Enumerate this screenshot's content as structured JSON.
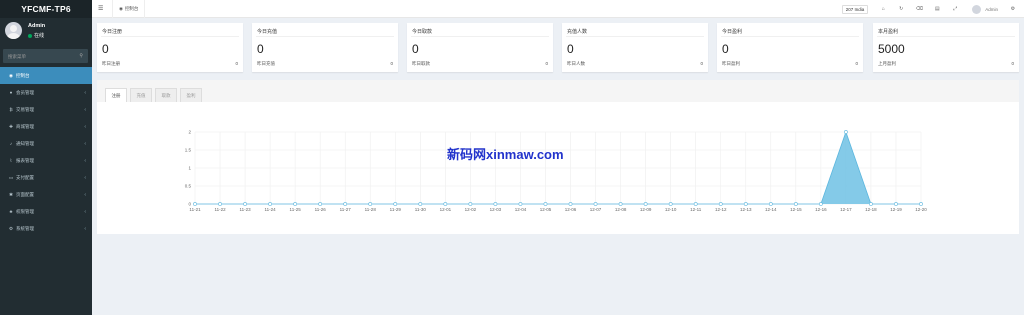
{
  "app": {
    "logo": "YFCMF-TP6"
  },
  "user": {
    "name": "Admin",
    "status": "在线"
  },
  "search": {
    "placeholder": "搜索菜单"
  },
  "menu": [
    {
      "label": "控制台",
      "icon": "dashboard-icon",
      "glyph": "◉",
      "active": true,
      "chevron": false
    },
    {
      "label": "会员管理",
      "icon": "user-icon",
      "glyph": "●",
      "active": false,
      "chevron": true
    },
    {
      "label": "交易管理",
      "icon": "bitcoin-icon",
      "glyph": "₿",
      "active": false,
      "chevron": true
    },
    {
      "label": "商城管理",
      "icon": "shop-icon",
      "glyph": "✚",
      "active": false,
      "chevron": true
    },
    {
      "label": "通知管理",
      "icon": "bell-icon",
      "glyph": "♪",
      "active": false,
      "chevron": true
    },
    {
      "label": "报表管理",
      "icon": "chart-icon",
      "glyph": "⌇",
      "active": false,
      "chevron": true
    },
    {
      "label": "支付配置",
      "icon": "card-icon",
      "glyph": "▭",
      "active": false,
      "chevron": true
    },
    {
      "label": "页面配置",
      "icon": "gear-icon",
      "glyph": "✱",
      "active": false,
      "chevron": true
    },
    {
      "label": "权限管理",
      "icon": "users-icon",
      "glyph": "♣",
      "active": false,
      "chevron": true
    },
    {
      "label": "系统管理",
      "icon": "cogs-icon",
      "glyph": "⚙",
      "active": false,
      "chevron": true
    }
  ],
  "topbar": {
    "tab_label": "控制台",
    "india_label": "207 India",
    "admin_label": "Admin"
  },
  "stats": [
    {
      "title": "今日注册",
      "value": "0",
      "sub_label": "昨日注册",
      "sub_value": "0"
    },
    {
      "title": "今日充值",
      "value": "0",
      "sub_label": "昨日充值",
      "sub_value": "0"
    },
    {
      "title": "今日取款",
      "value": "0",
      "sub_label": "昨日取款",
      "sub_value": "0"
    },
    {
      "title": "充值人数",
      "value": "0",
      "sub_label": "昨日人数",
      "sub_value": "0"
    },
    {
      "title": "今日盈利",
      "value": "0",
      "sub_label": "昨日盈利",
      "sub_value": "0"
    },
    {
      "title": "本月盈利",
      "value": "5000",
      "sub_label": "上月盈利",
      "sub_value": "0"
    }
  ],
  "panel": {
    "tabs": [
      {
        "label": "注册",
        "active": true
      },
      {
        "label": "充值",
        "active": false
      },
      {
        "label": "取款",
        "active": false
      },
      {
        "label": "盈利",
        "active": false
      }
    ]
  },
  "watermark": "新码网xinmaw.com",
  "colors": {
    "sidebar": "#222d32",
    "accent": "#3c8dbc",
    "area_fill": "#6ec1e4",
    "online": "#00a65a"
  },
  "chart_data": {
    "type": "area",
    "x": [
      "11-21",
      "11-22",
      "11-23",
      "11-24",
      "11-25",
      "11-26",
      "11-27",
      "11-28",
      "11-29",
      "11-30",
      "12-01",
      "12-02",
      "12-03",
      "12-04",
      "12-05",
      "12-06",
      "12-07",
      "12-08",
      "12-09",
      "12-10",
      "12-11",
      "12-12",
      "12-13",
      "12-14",
      "12-15",
      "12-16",
      "12-17",
      "12-18",
      "12-19",
      "12-20"
    ],
    "series": [
      {
        "values": [
          0,
          0,
          0,
          0,
          0,
          0,
          0,
          0,
          0,
          0,
          0,
          0,
          0,
          0,
          0,
          0,
          0,
          0,
          0,
          0,
          0,
          0,
          0,
          0,
          0,
          0,
          2,
          0,
          0,
          0
        ]
      }
    ],
    "yticks": [
      "0",
      "0.5",
      "1",
      "1.5",
      "2"
    ],
    "ylim": [
      0,
      2
    ],
    "grid": true
  }
}
